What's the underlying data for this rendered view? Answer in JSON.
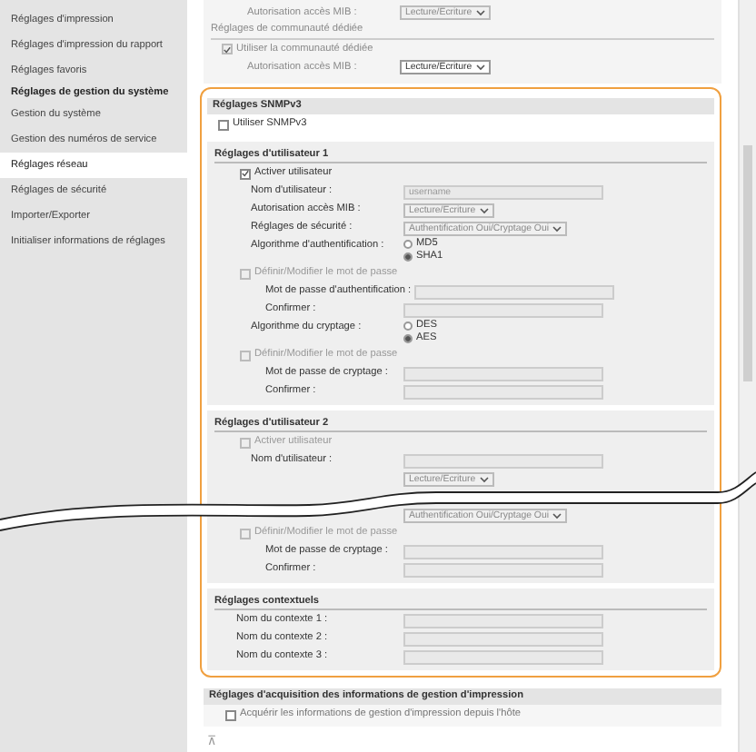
{
  "sidebar": {
    "items": [
      {
        "label": "Réglages d'impression",
        "kind": "item",
        "selected": false
      },
      {
        "label": "Réglages d'impression du rapport",
        "kind": "item",
        "selected": false
      },
      {
        "label": "Réglages favoris",
        "kind": "item",
        "selected": false
      },
      {
        "label": "Réglages de gestion du système",
        "kind": "header",
        "selected": false
      },
      {
        "label": "Gestion du système",
        "kind": "item",
        "selected": false
      },
      {
        "label": "Gestion des numéros de service",
        "kind": "item",
        "selected": false
      },
      {
        "label": "Réglages réseau",
        "kind": "item",
        "selected": true
      },
      {
        "label": "Réglages de sécurité",
        "kind": "item",
        "selected": false
      },
      {
        "label": "Importer/Exporter",
        "kind": "item",
        "selected": false
      },
      {
        "label": "Initialiser informations de réglages",
        "kind": "item",
        "selected": false
      }
    ]
  },
  "top_section": {
    "rows": [
      {
        "kind": "select",
        "label": "Autorisation accès MIB :",
        "value": "Lecture/Ecriture",
        "disabled": true
      },
      {
        "kind": "heading",
        "label": "Réglages de communauté dédiée"
      },
      {
        "kind": "checkbox",
        "label": "Utiliser la communauté dédiée",
        "checked": true,
        "disabled": true
      },
      {
        "kind": "select",
        "label": "Autorisation accès MIB :",
        "value": "Lecture/Ecriture",
        "disabled": false
      }
    ]
  },
  "snmpv3": {
    "title": "Réglages SNMPv3",
    "use": {
      "label": "Utiliser SNMPv3",
      "checked": false
    },
    "groups": [
      {
        "title": "Réglages d'utilisateur 1",
        "rows": [
          {
            "kind": "checkbox",
            "label": "Activer utilisateur",
            "checked": true,
            "disabled": false
          },
          {
            "kind": "field",
            "label": "Nom d'utilisateur :",
            "value": "username",
            "disabled": true
          },
          {
            "kind": "select",
            "label": "Autorisation accès MIB :",
            "value": "Lecture/Ecriture",
            "disabled": true
          },
          {
            "kind": "select",
            "label": "Réglages de sécurité :",
            "value": "Authentification Oui/Cryptage Oui",
            "disabled": true
          },
          {
            "kind": "radios",
            "label": "Algorithme d'authentification :",
            "options": [
              {
                "label": "MD5",
                "selected": false
              },
              {
                "label": "SHA1",
                "selected": true
              }
            ]
          },
          {
            "kind": "checkbox",
            "label": "Définir/Modifier le mot de passe",
            "checked": false,
            "disabled": true,
            "children": [
              {
                "kind": "field",
                "label": "Mot de passe d'authentification :",
                "disabled": true
              },
              {
                "kind": "field",
                "label": "Confirmer :",
                "disabled": true
              }
            ]
          },
          {
            "kind": "radios",
            "label": "Algorithme du cryptage :",
            "options": [
              {
                "label": "DES",
                "selected": false
              },
              {
                "label": "AES",
                "selected": true
              }
            ]
          },
          {
            "kind": "checkbox",
            "label": "Définir/Modifier le mot de passe",
            "checked": false,
            "disabled": true,
            "children": [
              {
                "kind": "field",
                "label": "Mot de passe de cryptage :",
                "disabled": true
              },
              {
                "kind": "field",
                "label": "Confirmer :",
                "disabled": true
              }
            ]
          }
        ]
      },
      {
        "title": "Réglages d'utilisateur 2",
        "rows": [
          {
            "kind": "checkbox",
            "label": "Activer utilisateur",
            "checked": false,
            "disabled": true
          },
          {
            "kind": "field",
            "label": "Nom d'utilisateur :",
            "disabled": true
          },
          {
            "kind": "select",
            "value": "Lecture/Ecriture",
            "disabled": true
          },
          {
            "kind": "select",
            "value": "Authentification Oui/Cryptage Oui",
            "disabled": true
          },
          {
            "kind": "checkbox",
            "label": "Définir/Modifier le mot de passe",
            "checked": false,
            "disabled": true,
            "children": [
              {
                "kind": "field",
                "label": "Mot de passe de cryptage :",
                "disabled": true
              },
              {
                "kind": "field",
                "label": "Confirmer :",
                "disabled": true
              }
            ]
          }
        ]
      },
      {
        "title": "Réglages contextuels",
        "rows": [
          {
            "kind": "field",
            "label": "Nom du contexte 1 :",
            "disabled": true
          },
          {
            "kind": "field",
            "label": "Nom du contexte 2 :",
            "disabled": true
          },
          {
            "kind": "field",
            "label": "Nom du contexte 3 :",
            "disabled": true
          }
        ]
      }
    ]
  },
  "print_management": {
    "title": "Réglages d'acquisition des informations de gestion d'impression",
    "option": {
      "label": "Acquérir les informations de gestion d'impression depuis l'hôte",
      "checked": false
    }
  },
  "back_to_top": "⊼"
}
